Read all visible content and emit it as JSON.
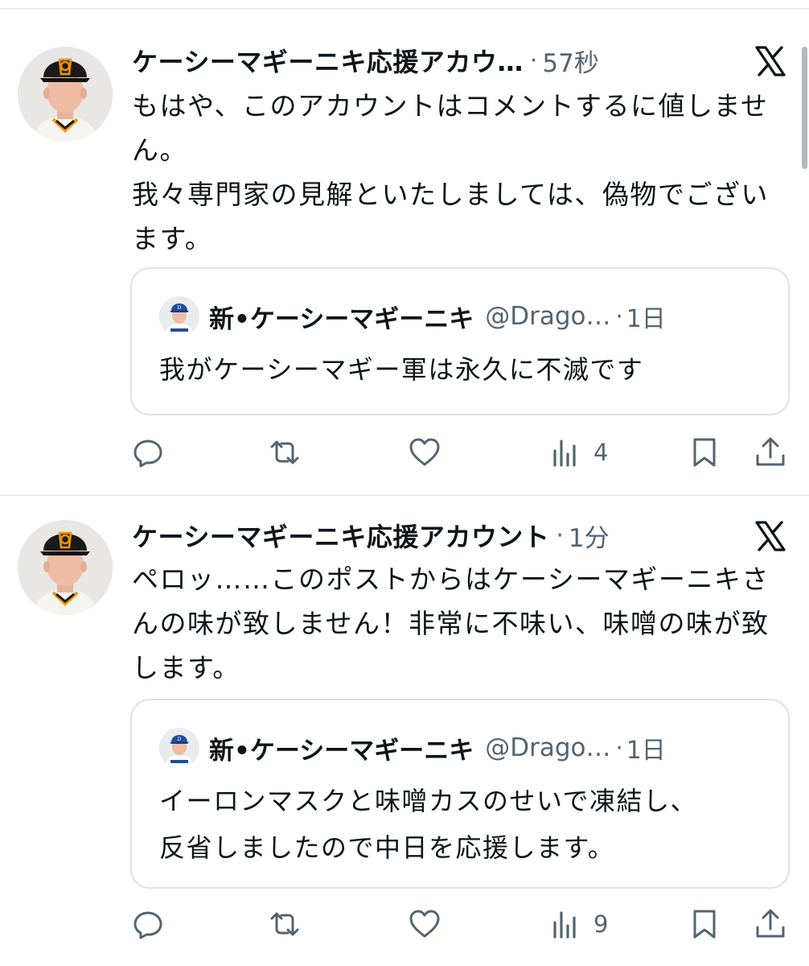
{
  "posts": [
    {
      "author": "ケーシーマギーニキ応援アカウ…",
      "dot": "·",
      "time": "57秒",
      "text": "もはや、このアカウントはコメントするに値しません。\n我々専門家の見解といたしましては、偽物でございます。",
      "quote": {
        "author": "新•ケーシーマギーニキ",
        "handle": "@Drago…",
        "dot": "·",
        "time": "1日",
        "text": "我がケーシーマギー軍は永久に不滅です"
      },
      "views": "4"
    },
    {
      "author": "ケーシーマギーニキ応援アカウント",
      "dot": "·",
      "time": "1分",
      "text": "ペロッ……このポストからはケーシーマギーニキさんの味が致しません！非常に不味い、味噌の味が致します。",
      "quote": {
        "author": "新•ケーシーマギーニキ",
        "handle": "@Drago…",
        "dot": "·",
        "time": "1日",
        "text": "イーロンマスクと味噌カスのせいで凍結し、\n反省しましたので中日を応援します。"
      },
      "views": "9"
    }
  ],
  "icons": {
    "reply": "reply-icon",
    "retweet": "retweet-icon",
    "like": "like-icon",
    "views": "views-icon",
    "bookmark": "bookmark-icon",
    "share": "share-icon",
    "brand": "x-logo-icon"
  },
  "colors": {
    "text": "#0f1419",
    "secondary": "#536471",
    "border": "#dfe3e6",
    "cap_orange": "#f29600",
    "cap_black": "#1a1a1a",
    "dragons_blue": "#1f4d9e"
  }
}
